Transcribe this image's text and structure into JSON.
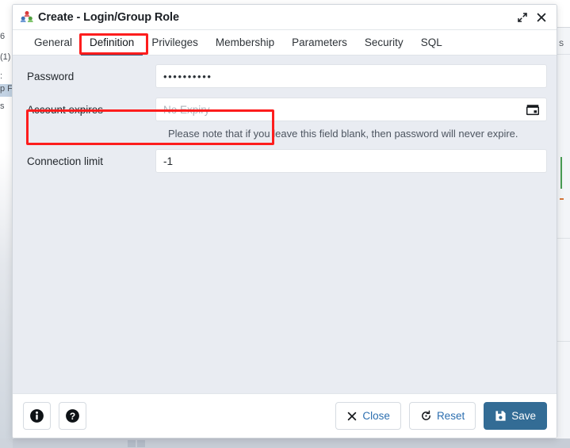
{
  "window": {
    "title": "Create - Login/Group Role",
    "icon": "group-role-icon",
    "maximize_label": "⤡",
    "close_label": "✕"
  },
  "tabs": [
    {
      "label": "General",
      "active": false
    },
    {
      "label": "Definition",
      "active": true
    },
    {
      "label": "Privileges",
      "active": false
    },
    {
      "label": "Membership",
      "active": false
    },
    {
      "label": "Parameters",
      "active": false
    },
    {
      "label": "Security",
      "active": false
    },
    {
      "label": "SQL",
      "active": false
    }
  ],
  "form": {
    "password": {
      "label": "Password",
      "value": "••••••••••",
      "placeholder": ""
    },
    "account_expires": {
      "label": "Account expires",
      "value": "",
      "placeholder": "No Expiry",
      "icon": "calendar-icon"
    },
    "hint": "Please note that if you leave this field blank, then password will never expire.",
    "connection_limit": {
      "label": "Connection limit",
      "value": "-1",
      "placeholder": ""
    }
  },
  "footer": {
    "info_label": "i",
    "help_label": "?",
    "close_label": "Close",
    "reset_label": "Reset",
    "save_label": "Save"
  },
  "annotations": {
    "tab_highlight": "Definition",
    "field_highlight": "Password",
    "color": "#fd1d1d"
  },
  "background": {
    "tree_fragments": [
      "6",
      "(1)",
      ":",
      "p F",
      "s"
    ],
    "right_fragment": "S"
  },
  "colors": {
    "accent": "#336c95",
    "tab_underline": "#33597c",
    "link": "#2c6fb0",
    "form_bg": "#e9ecf2",
    "annotation": "#fd1d1d"
  }
}
